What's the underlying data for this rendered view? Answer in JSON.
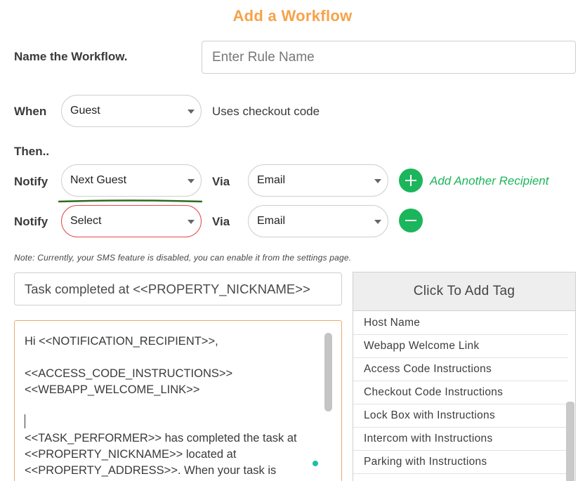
{
  "page": {
    "title": "Add a Workflow"
  },
  "name_row": {
    "label": "Name the Workflow.",
    "placeholder": "Enter Rule Name"
  },
  "when_row": {
    "label": "When",
    "select_value": "Guest",
    "trailing_text": "Uses checkout code"
  },
  "then_label": "Then..",
  "notify_rows": [
    {
      "label": "Notify",
      "recipient": "Next Guest",
      "via_label": "Via",
      "via_value": "Email",
      "action": "Add Another Recipient"
    },
    {
      "label": "Notify",
      "recipient": "Select",
      "via_label": "Via",
      "via_value": "Email"
    }
  ],
  "note": "Note: Currently, your SMS feature is disabled, you can enable it from the settings page.",
  "subject": "Task completed at  <<PROPERTY_NICKNAME>>",
  "message_lines": [
    "Hi <<NOTIFICATION_RECIPIENT>>,",
    "",
    "<<ACCESS_CODE_INSTRUCTIONS>>",
    "<<WEBAPP_WELCOME_LINK>>",
    "",
    "",
    "<<TASK_PERFORMER>> has completed the task at",
    "<<PROPERTY_NICKNAME>> located at",
    "<<PROPERTY_ADDRESS>>. When your task is"
  ],
  "tag_panel": {
    "header": "Click To Add Tag",
    "tags": [
      "Host Name",
      "Webapp Welcome Link",
      "Access Code Instructions",
      "Checkout Code Instructions",
      "Lock Box with Instructions",
      "Intercom with Instructions",
      "Parking with Instructions"
    ]
  },
  "colors": {
    "title": "#f7a24a",
    "accent_green": "#1bb55c",
    "error_red": "#e24a4a",
    "editor_border": "#f0a86b",
    "underline": "#2f6b1e"
  }
}
